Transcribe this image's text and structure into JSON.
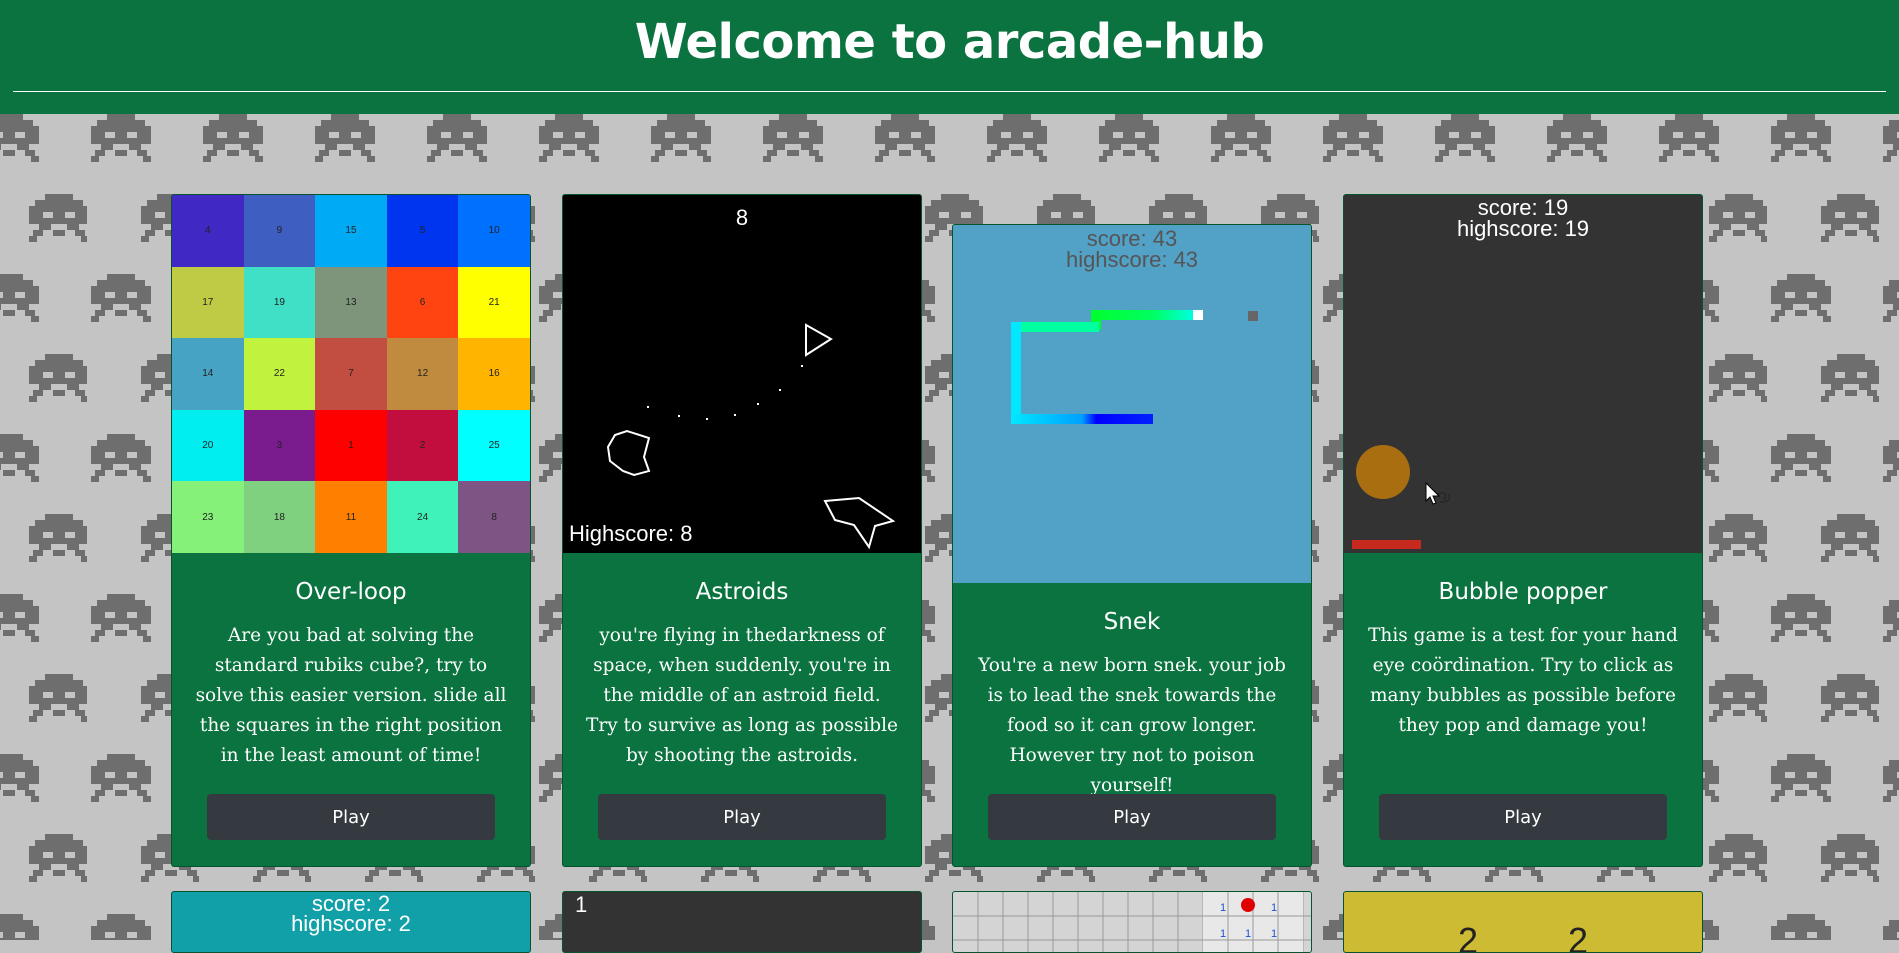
{
  "header": {
    "title": "Welcome to arcade-hub"
  },
  "colors": {
    "header_bg": "#0a7340",
    "page_bg": "#c4c4c4",
    "invader": "#6e6e6e",
    "button_bg": "#343a40"
  },
  "cards": [
    {
      "title": "Over-loop",
      "description": "Are you bad at solving the standard rubiks cube?, try to solve this easier version. slide all the squares in the right position in the least amount of time!",
      "button": "Play",
      "tiles": [
        {
          "n": "4",
          "c": "#3f28c4"
        },
        {
          "n": "9",
          "c": "#3e5fc1"
        },
        {
          "n": "15",
          "c": "#00aaf5"
        },
        {
          "n": "5",
          "c": "#0035f0"
        },
        {
          "n": "10",
          "c": "#0070ff"
        },
        {
          "n": "17",
          "c": "#c0cb45"
        },
        {
          "n": "19",
          "c": "#3fe0c6"
        },
        {
          "n": "13",
          "c": "#7e957c"
        },
        {
          "n": "6",
          "c": "#ff4411"
        },
        {
          "n": "21",
          "c": "#ffff00"
        },
        {
          "n": "14",
          "c": "#47a3c4"
        },
        {
          "n": "22",
          "c": "#c0f23e"
        },
        {
          "n": "7",
          "c": "#c24e42"
        },
        {
          "n": "12",
          "c": "#c08b3f"
        },
        {
          "n": "16",
          "c": "#ffb400"
        },
        {
          "n": "20",
          "c": "#00eef0"
        },
        {
          "n": "3",
          "c": "#7b1c8e"
        },
        {
          "n": "1",
          "c": "#ff0000"
        },
        {
          "n": "2",
          "c": "#c20e3e"
        },
        {
          "n": "25",
          "c": "#00ffff"
        },
        {
          "n": "23",
          "c": "#85f179"
        },
        {
          "n": "18",
          "c": "#7fd07f"
        },
        {
          "n": "11",
          "c": "#ff7f00"
        },
        {
          "n": "24",
          "c": "#3ff2b9"
        },
        {
          "n": "8",
          "c": "#7d5484"
        }
      ]
    },
    {
      "title": "Astroids",
      "description": "you're flying in thedarkness of space, when suddenly. you're in the middle of an astroid field. Try to survive as long as possible by shooting the astroids.",
      "button": "Play",
      "score": "8",
      "highscore": "Highscore: 8"
    },
    {
      "title": "Snek",
      "description": "You're a new born snek. your job is to lead the snek towards the food so it can grow longer. However try not to poison yourself!",
      "button": "Play",
      "score": "score: 43",
      "highscore": "highscore: 43"
    },
    {
      "title": "Bubble popper",
      "description": "This game is a test for your hand eye coördination. Try to click as many bubbles as possible before they pop and damage you!",
      "button": "Play",
      "score": "score: 19",
      "highscore": "highscore: 19"
    }
  ],
  "row2": [
    {
      "score": "score: 2",
      "highscore": "highscore: 2"
    },
    {
      "score": "1"
    },
    {
      "cells": [
        "1",
        "1",
        "1",
        "1",
        "1"
      ]
    },
    {
      "text": "2 2"
    }
  ]
}
